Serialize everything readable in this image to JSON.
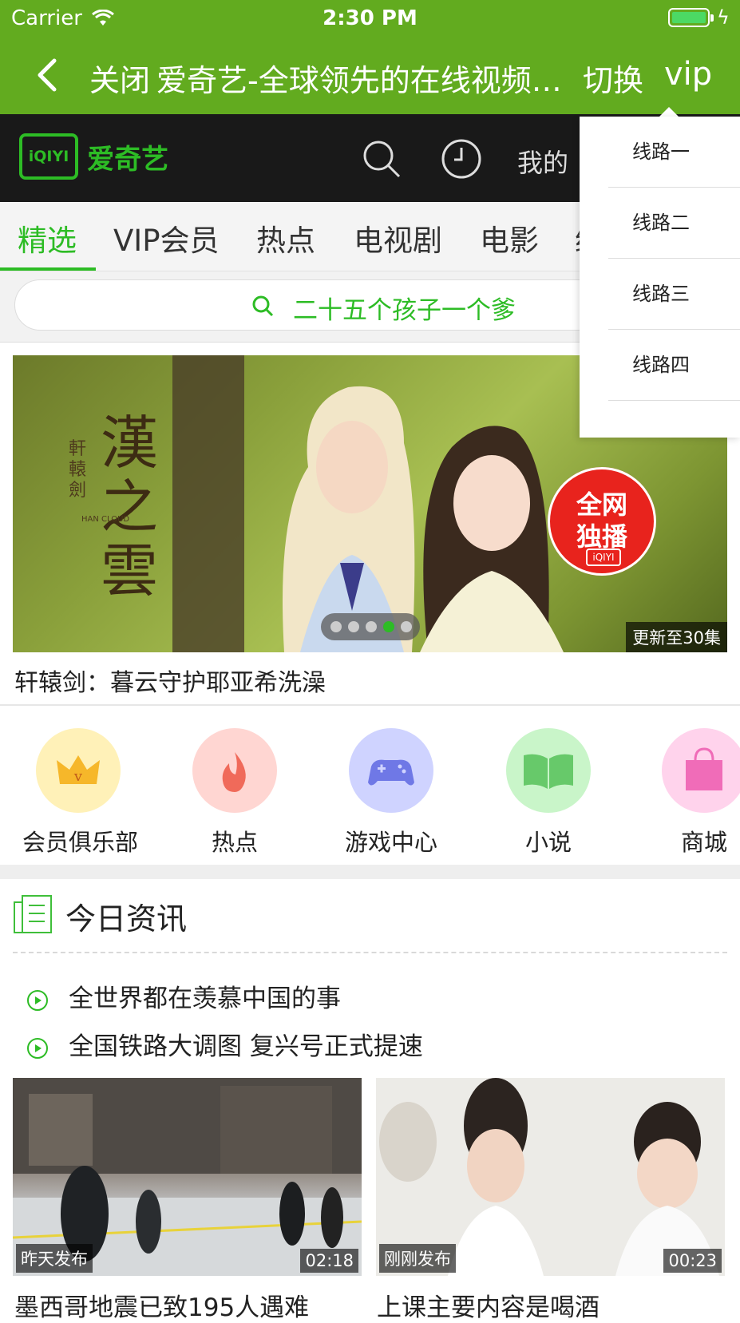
{
  "status": {
    "carrier": "Carrier",
    "time": "2:30 PM"
  },
  "nav": {
    "close": "关闭",
    "title": "爱奇艺-全球领先的在线视频…",
    "switch": "切换",
    "vip": "vip"
  },
  "header": {
    "logo_mark": "iQIYI",
    "logo_text": "爱奇艺",
    "my": "我的"
  },
  "tabs": [
    "精选",
    "VIP会员",
    "热点",
    "电视剧",
    "电影",
    "综"
  ],
  "search": {
    "placeholder": "二十五个孩子一个爹"
  },
  "banner": {
    "poster_calligraphy": "漢之雲",
    "poster_side": "軒轅劍",
    "poster_en": "HAN CLOUD",
    "badge_line1": "全网",
    "badge_line2": "独播",
    "badge_logo": "iQIYI",
    "episode": "更新至30集",
    "title": "轩辕剑：暮云守护耶亚希洗澡",
    "active_dot": 4
  },
  "categories": [
    {
      "label": "会员俱乐部",
      "icon": "crown-icon",
      "color": "#fff1b8"
    },
    {
      "label": "热点",
      "icon": "flame-icon",
      "color": "#ffd6d2"
    },
    {
      "label": "游戏中心",
      "icon": "gamepad-icon",
      "color": "#cfd3ff"
    },
    {
      "label": "小说",
      "icon": "book-icon",
      "color": "#c9f5c9"
    },
    {
      "label": "商城",
      "icon": "shopping-bag-icon",
      "color": "#ffd3ec"
    }
  ],
  "news": {
    "heading": "今日资讯",
    "items": [
      "全世界都在羡慕中国的事",
      "全国铁路大调图 复兴号正式提速"
    ],
    "videos": [
      {
        "label": "昨天发布",
        "duration": "02:18",
        "title": "墨西哥地震已致195人遇难"
      },
      {
        "label": "刚刚发布",
        "duration": "00:23",
        "title": "上课主要内容是喝酒"
      }
    ]
  },
  "menu": {
    "items": [
      "线路一",
      "线路二",
      "线路三",
      "线路四"
    ]
  }
}
